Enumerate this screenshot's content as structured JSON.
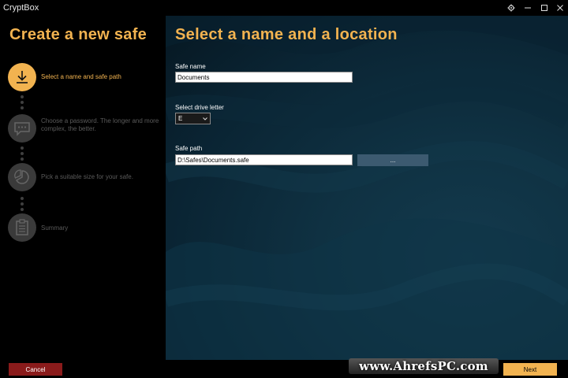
{
  "window": {
    "title": "CryptBox"
  },
  "sidebar": {
    "heading": "Create a new safe",
    "steps": [
      {
        "label": "Select a name and safe path",
        "icon": "download-icon",
        "active": true
      },
      {
        "label": "Choose a password. The longer and more complex, the better.",
        "icon": "chat-bubble-icon",
        "active": false
      },
      {
        "label": "Pick a suitable size for your safe.",
        "icon": "pie-chart-icon",
        "active": false
      },
      {
        "label": "Summary",
        "icon": "clipboard-icon",
        "active": false
      }
    ]
  },
  "main": {
    "heading": "Select a name and a location",
    "safe_name": {
      "label": "Safe name",
      "value": "Documents"
    },
    "drive_letter": {
      "label": "Select drive letter",
      "value": "E"
    },
    "safe_path": {
      "label": "Safe path",
      "value": "D:\\Safes\\Documents.safe",
      "browse_label": "..."
    }
  },
  "footer": {
    "cancel_label": "Cancel",
    "next_label": "Next",
    "watermark": "www.AhrefsPC.com"
  },
  "colors": {
    "accent": "#f2b350",
    "cancel": "#8a1b1b",
    "browse": "#3c5a70",
    "background": "#000000",
    "panel": "#0f3142"
  }
}
